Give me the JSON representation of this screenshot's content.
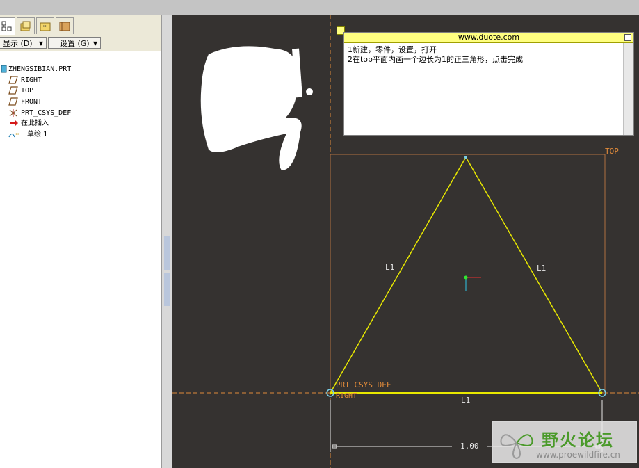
{
  "tabs": [
    {
      "name": "model-tree-tab",
      "icon": "model-tree-icon"
    },
    {
      "name": "folder-browser-tab",
      "icon": "folder-icon"
    },
    {
      "name": "favorites-tab",
      "icon": "favorites-icon"
    },
    {
      "name": "connections-tab",
      "icon": "connections-icon"
    }
  ],
  "toolbar": {
    "show_label": "显示 (D)",
    "settings_label": "设置 (G)"
  },
  "tree": {
    "root": "ZHENGSIBIAN.PRT",
    "items": [
      {
        "label": "RIGHT",
        "icon": "datum-plane-icon"
      },
      {
        "label": "TOP",
        "icon": "datum-plane-icon"
      },
      {
        "label": "FRONT",
        "icon": "datum-plane-icon"
      },
      {
        "label": "PRT_CSYS_DEF",
        "icon": "csys-icon"
      },
      {
        "label": "在此插入",
        "icon": "insert-here-arrow-icon"
      },
      {
        "label": "草绘 1",
        "icon": "sketch-icon"
      }
    ]
  },
  "note": {
    "title": "www.duote.com",
    "line1": "1新建，零件，设置，打开",
    "line2": "2在top平面内画一个边长为1的正三角形，点击完成"
  },
  "sketch": {
    "plane_label": "TOP",
    "csys_label": "PRT_CSYS_DEF",
    "right_label": "RIGHT",
    "side_label_left": "L1",
    "side_label_right": "L1",
    "side_label_bottom": "L1",
    "dimension_value": "1.00",
    "line_color": "#e8e800",
    "ref_color": "#e08a3a"
  },
  "watermark": {
    "title": "野火论坛",
    "url": "www.proewildfire.cn"
  },
  "colors": {
    "canvas_bg": "#353230",
    "panel_bg": "#ffffff",
    "accent_yellow": "#ffff80"
  }
}
